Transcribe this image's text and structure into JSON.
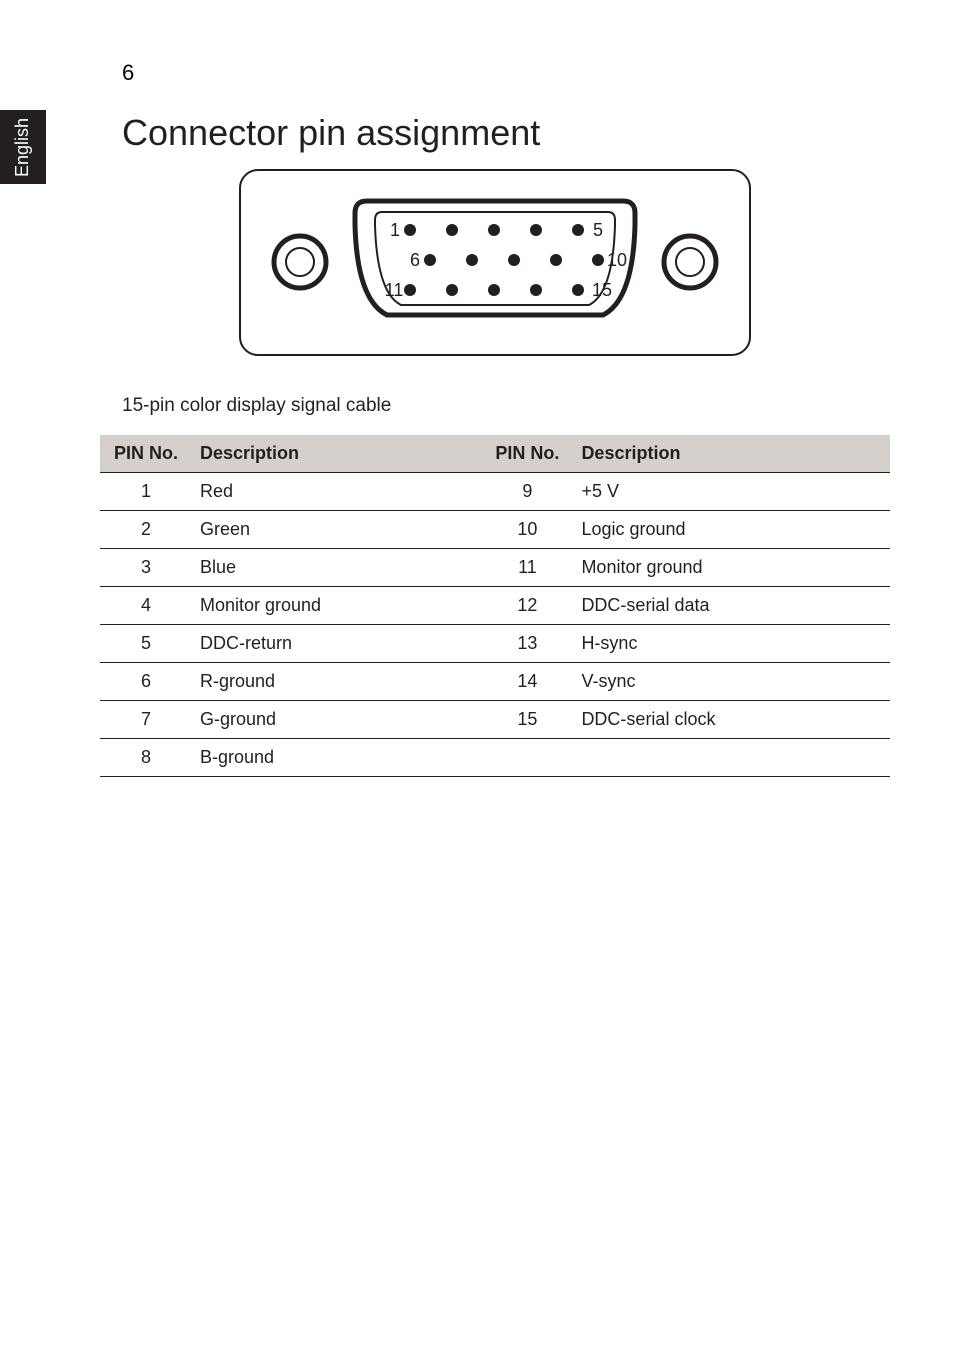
{
  "side_tab": "English",
  "page_number": "6",
  "heading": "Connector pin assignment",
  "caption": "15-pin color display signal cable",
  "chart_data": {
    "type": "table",
    "columns": [
      "PIN No.",
      "Description",
      "PIN No.",
      "Description"
    ],
    "rows": [
      {
        "pin1": "1",
        "desc1": "Red",
        "pin2": "9",
        "desc2": "+5 V"
      },
      {
        "pin1": "2",
        "desc1": "Green",
        "pin2": "10",
        "desc2": "Logic ground"
      },
      {
        "pin1": "3",
        "desc1": "Blue",
        "pin2": "11",
        "desc2": "Monitor ground"
      },
      {
        "pin1": "4",
        "desc1": "Monitor ground",
        "pin2": "12",
        "desc2": "DDC-serial data"
      },
      {
        "pin1": "5",
        "desc1": "DDC-return",
        "pin2": "13",
        "desc2": "H-sync"
      },
      {
        "pin1": "6",
        "desc1": "R-ground",
        "pin2": "14",
        "desc2": "V-sync"
      },
      {
        "pin1": "7",
        "desc1": "G-ground",
        "pin2": "15",
        "desc2": "DDC-serial clock"
      },
      {
        "pin1": "8",
        "desc1": "B-ground",
        "pin2": "",
        "desc2": ""
      }
    ]
  },
  "connector_labels": {
    "row1_start": "1",
    "row1_end": "5",
    "row2_start": "6",
    "row2_end": "10",
    "row3_start": "11",
    "row3_end": "15"
  }
}
